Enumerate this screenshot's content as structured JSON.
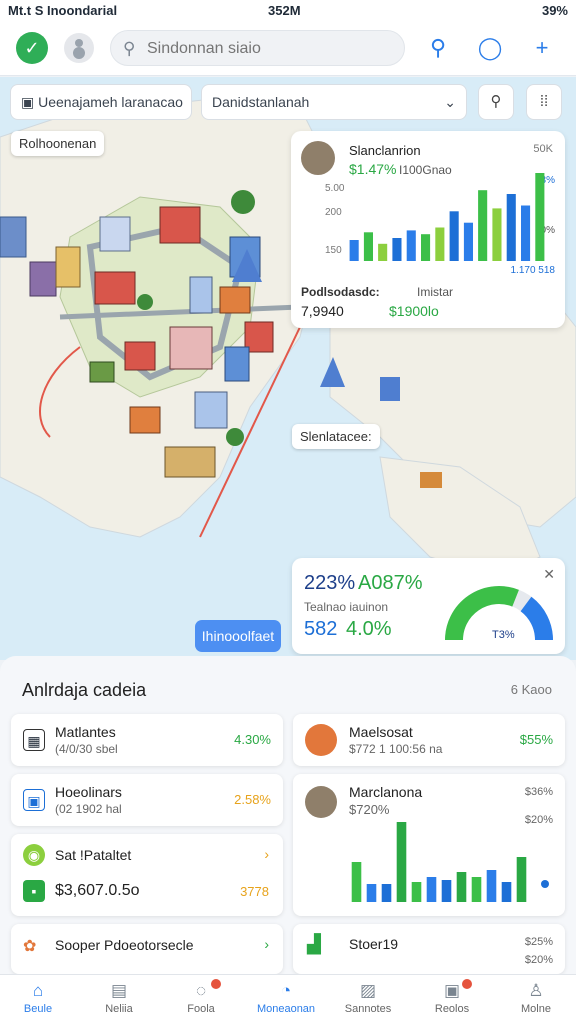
{
  "status": {
    "left": "Mt.t S Inoondarial",
    "time": "352M",
    "battery": "39%"
  },
  "appbar": {
    "search_placeholder": "Sindonnan siaio",
    "logo_glyph": "✓"
  },
  "map": {
    "filter_left": "Ueenajameh laranacao",
    "filter_right": "Danidstanlanah",
    "place_chip": "Rolhoonenan",
    "center_chip": "Slenlatacee:",
    "button": "Ihinooolfaet"
  },
  "stats_card": {
    "title": "Slanclanrion",
    "top_right": "50K",
    "pct": "$1.47%",
    "pct_sub": "I100Gnao",
    "right_axis": [
      "33%",
      "80%"
    ],
    "left_axis": [
      "5.00",
      "200",
      "150"
    ],
    "axis_right_bottom": "1.170 518",
    "label_left": "Podlsodasdc:",
    "label_right": "Imistar",
    "value_left": "7,9940",
    "value_right": "$1900lo",
    "bars": [
      22,
      30,
      18,
      24,
      32,
      28,
      35,
      52,
      40,
      74,
      55,
      70,
      58,
      92
    ]
  },
  "gauge_card": {
    "line1_a": "223%",
    "line1_b": "A087%",
    "label": "Tealnao iauinon",
    "line2_a": "582",
    "line2_b": "4.0%",
    "gauge_label": "T3%",
    "gauge_value": 0.62
  },
  "panel": {
    "title": "Anlrdaja cadeia",
    "meta": "6 Kaoo",
    "items": [
      {
        "name": "Matlantes",
        "sub": "(4/0/30 sbel",
        "value": "4.30%",
        "icon": "▦"
      },
      {
        "name": "Maelsosat",
        "sub": "$772 1 100:56 na",
        "value": "$55%"
      },
      {
        "name": "Hoeolinars",
        "sub": "(02 1902 hal",
        "value": "2.58%",
        "icon": "▣"
      },
      {
        "name": "Marclanona",
        "sub": "$720%",
        "value": "$36%",
        "value2": "$20%"
      },
      {
        "name": "Sat !Pataltet",
        "sub": "$3,607.0.5o",
        "value": "3778",
        "icon": "◉"
      },
      {
        "name": "Sooper Pdoeotorsecle",
        "value": ""
      },
      {
        "name": "Stoer19",
        "value": "$25%",
        "value2": "$20%"
      }
    ],
    "mini_bars": [
      40,
      18,
      18,
      80,
      20,
      25,
      22,
      30,
      25,
      32,
      20,
      45
    ]
  },
  "nav": [
    {
      "label": "Beule",
      "icon": "⌂",
      "active": true
    },
    {
      "label": "Neliia",
      "icon": "▤",
      "active": false
    },
    {
      "label": "Foola",
      "icon": "◌",
      "active": false
    },
    {
      "label": "Moneaonan",
      "icon": "◔",
      "active": false
    },
    {
      "label": "Sannotes",
      "icon": "▨",
      "active": false
    },
    {
      "label": "Reolos",
      "icon": "▣",
      "active": false
    },
    {
      "label": "Molne",
      "icon": "♙",
      "active": false
    }
  ]
}
